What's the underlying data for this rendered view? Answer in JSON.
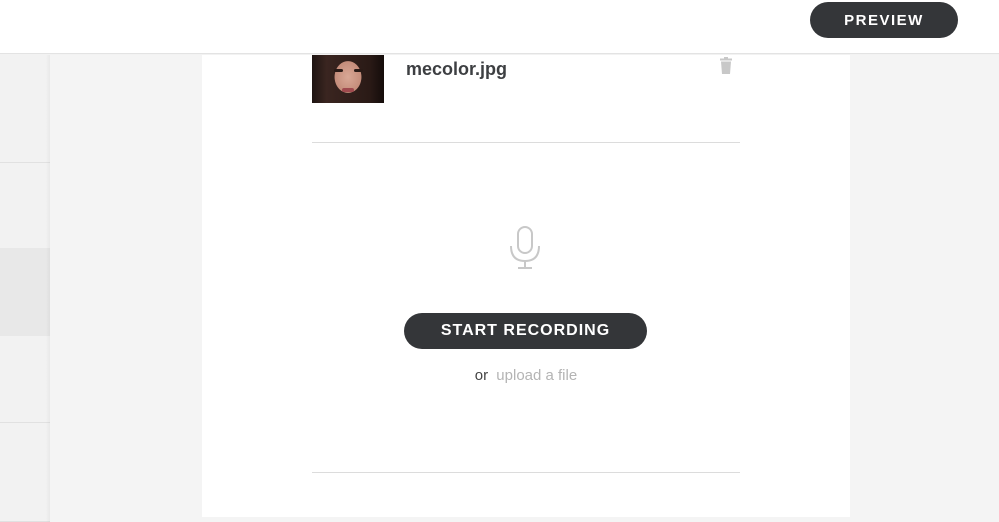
{
  "header": {
    "preview_label": "PREVIEW"
  },
  "file": {
    "name": "mecolor.jpg",
    "thumbnail_icon": "photo-thumbnail",
    "delete_icon": "trash-icon"
  },
  "recorder": {
    "mic_icon": "microphone-icon",
    "start_label": "START RECORDING",
    "or_text": "or",
    "upload_label": "upload a file"
  },
  "colors": {
    "button_bg": "#343639",
    "link_muted": "#b4b4b4",
    "icon_muted": "#c8c8c8"
  }
}
